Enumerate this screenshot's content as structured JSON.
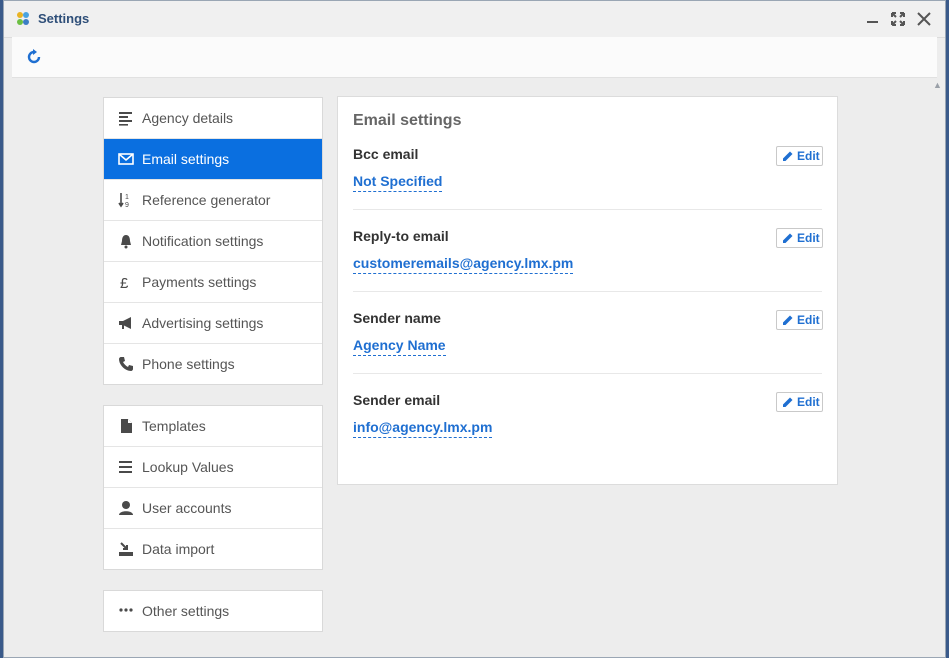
{
  "window": {
    "title": "Settings"
  },
  "menu_groups": [
    [
      {
        "label": "Agency details",
        "icon": "align-left-icon",
        "active": false
      },
      {
        "label": "Email settings",
        "icon": "envelope-icon",
        "active": true
      },
      {
        "label": "Reference generator",
        "icon": "sort-numeric-icon",
        "active": false
      },
      {
        "label": "Notification settings",
        "icon": "bell-icon",
        "active": false
      },
      {
        "label": "Payments settings",
        "icon": "pound-icon",
        "active": false
      },
      {
        "label": "Advertising settings",
        "icon": "megaphone-icon",
        "active": false
      },
      {
        "label": "Phone settings",
        "icon": "phone-icon",
        "active": false
      }
    ],
    [
      {
        "label": "Templates",
        "icon": "file-icon",
        "active": false
      },
      {
        "label": "Lookup Values",
        "icon": "list-icon",
        "active": false
      },
      {
        "label": "User accounts",
        "icon": "user-icon",
        "active": false
      },
      {
        "label": "Data import",
        "icon": "import-icon",
        "active": false
      }
    ],
    [
      {
        "label": "Other settings",
        "icon": "ellipsis-icon",
        "active": false
      }
    ]
  ],
  "panel": {
    "title": "Email settings",
    "edit_label": "Edit",
    "fields": [
      {
        "label": "Bcc email",
        "value": "Not Specified"
      },
      {
        "label": "Reply-to email",
        "value": "customeremails@agency.lmx.pm"
      },
      {
        "label": "Sender name",
        "value": "Agency Name"
      },
      {
        "label": "Sender email",
        "value": "info@agency.lmx.pm"
      }
    ]
  },
  "colors": {
    "accent": "#0a6fe0",
    "link": "#1f6fd1",
    "title": "#2f4f79"
  }
}
